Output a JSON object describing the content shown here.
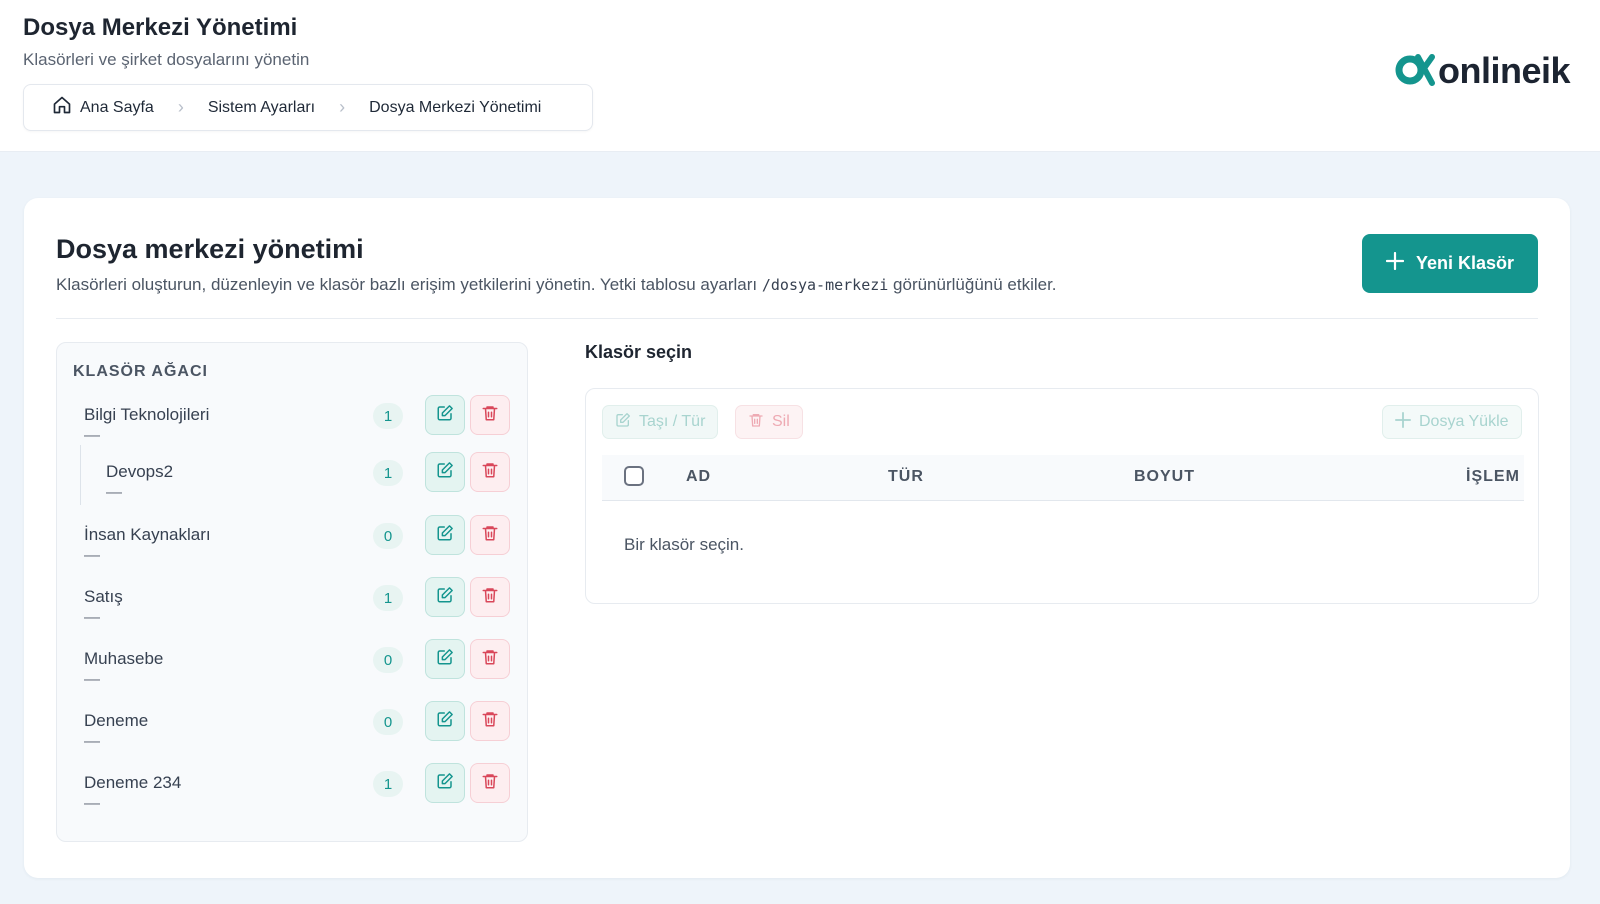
{
  "header": {
    "title": "Dosya Merkezi Yönetimi",
    "subtitle": "Klasörleri ve şirket dosyalarını yönetin",
    "breadcrumb": [
      "Ana Sayfa",
      "Sistem Ayarları",
      "Dosya Merkezi Yönetimi"
    ],
    "logo_text": "onlineik"
  },
  "card": {
    "title": "Dosya merkezi yönetimi",
    "desc_before": "Klasörleri oluşturun, düzenleyin ve klasör bazlı erişim yetkilerini yönetin. Yetki tablosu ayarları",
    "desc_code": "/dosya-merkezi",
    "desc_after": "görünürlüğünü etkiler.",
    "new_folder_label": "Yeni Klasör"
  },
  "tree": {
    "heading": "KLASÖR AĞACI",
    "items": [
      {
        "name": "Bilgi Teknolojileri",
        "sub": "—",
        "count": "1"
      },
      {
        "name": "Devops2",
        "sub": "—",
        "count": "1"
      },
      {
        "name": "İnsan Kaynakları",
        "sub": "—",
        "count": "0"
      },
      {
        "name": "Satış",
        "sub": "—",
        "count": "1"
      },
      {
        "name": "Muhasebe",
        "sub": "—",
        "count": "0"
      },
      {
        "name": "Deneme",
        "sub": "—",
        "count": "0"
      },
      {
        "name": "Deneme 234",
        "sub": "—",
        "count": "1"
      }
    ]
  },
  "detail": {
    "title": "Klasör seçin",
    "move_label": "Taşı / Tür",
    "delete_label": "Sil",
    "upload_label": "Dosya Yükle",
    "columns": [
      "AD",
      "TÜR",
      "BOYUT",
      "İŞLEM"
    ],
    "empty_text": "Bir klasör seçin."
  },
  "colors": {
    "accent": "#14958e",
    "danger": "#d9475a",
    "logo_mark": "#14958e"
  }
}
